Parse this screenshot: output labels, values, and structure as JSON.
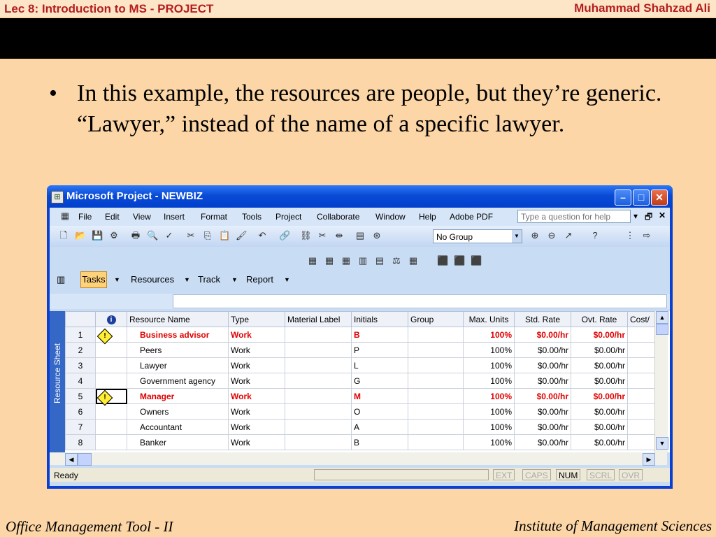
{
  "slide": {
    "header_left": "Lec 8: Introduction to MS - PROJECT",
    "header_right": "Muhammad Shahzad Ali",
    "bullet": "In this example, the resources are people, but they’re generic.  “Lawyer,” instead of the name of a specific lawyer.",
    "footer_left": "Office Management Tool - II",
    "footer_right": "Institute of Management Sciences"
  },
  "window": {
    "title": "Microsoft Project - NEWBIZ",
    "menu": [
      "File",
      "Edit",
      "View",
      "Insert",
      "Format",
      "Tools",
      "Project",
      "Collaborate",
      "Window",
      "Help",
      "Adobe PDF"
    ],
    "ask_placeholder": "Type a question for help",
    "group_select": "No Group",
    "guide": {
      "tasks": "Tasks",
      "resources": "Resources",
      "track": "Track",
      "report": "Report"
    },
    "side_tab": "Resource Sheet",
    "status": {
      "ready": "Ready",
      "ext": "EXT",
      "caps": "CAPS",
      "num": "NUM",
      "scrl": "SCRL",
      "ovr": "OVR"
    }
  },
  "table": {
    "columns": [
      "",
      "i",
      "Resource Name",
      "Type",
      "Material Label",
      "Initials",
      "Group",
      "Max. Units",
      "Std. Rate",
      "Ovt. Rate",
      "Cost/"
    ],
    "rows": [
      {
        "id": "1",
        "warn": true,
        "name": "Business advisor",
        "type": "Work",
        "material": "",
        "initials": "B",
        "group": "",
        "max": "100%",
        "std": "$0.00/hr",
        "ovt": "$0.00/hr"
      },
      {
        "id": "2",
        "warn": false,
        "name": "Peers",
        "type": "Work",
        "material": "",
        "initials": "P",
        "group": "",
        "max": "100%",
        "std": "$0.00/hr",
        "ovt": "$0.00/hr"
      },
      {
        "id": "3",
        "warn": false,
        "name": "Lawyer",
        "type": "Work",
        "material": "",
        "initials": "L",
        "group": "",
        "max": "100%",
        "std": "$0.00/hr",
        "ovt": "$0.00/hr"
      },
      {
        "id": "4",
        "warn": false,
        "name": "Government agency",
        "type": "Work",
        "material": "",
        "initials": "G",
        "group": "",
        "max": "100%",
        "std": "$0.00/hr",
        "ovt": "$0.00/hr"
      },
      {
        "id": "5",
        "warn": true,
        "name": "Manager",
        "type": "Work",
        "material": "",
        "initials": "M",
        "group": "",
        "max": "100%",
        "std": "$0.00/hr",
        "ovt": "$0.00/hr"
      },
      {
        "id": "6",
        "warn": false,
        "name": "Owners",
        "type": "Work",
        "material": "",
        "initials": "O",
        "group": "",
        "max": "100%",
        "std": "$0.00/hr",
        "ovt": "$0.00/hr"
      },
      {
        "id": "7",
        "warn": false,
        "name": "Accountant",
        "type": "Work",
        "material": "",
        "initials": "A",
        "group": "",
        "max": "100%",
        "std": "$0.00/hr",
        "ovt": "$0.00/hr"
      },
      {
        "id": "8",
        "warn": false,
        "name": "Banker",
        "type": "Work",
        "material": "",
        "initials": "B",
        "group": "",
        "max": "100%",
        "std": "$0.00/hr",
        "ovt": "$0.00/hr"
      }
    ]
  },
  "colors": {
    "overallocated": "#e00000",
    "titlebar": "#0a4bd6",
    "slide_bg": "#fcd6a6"
  }
}
